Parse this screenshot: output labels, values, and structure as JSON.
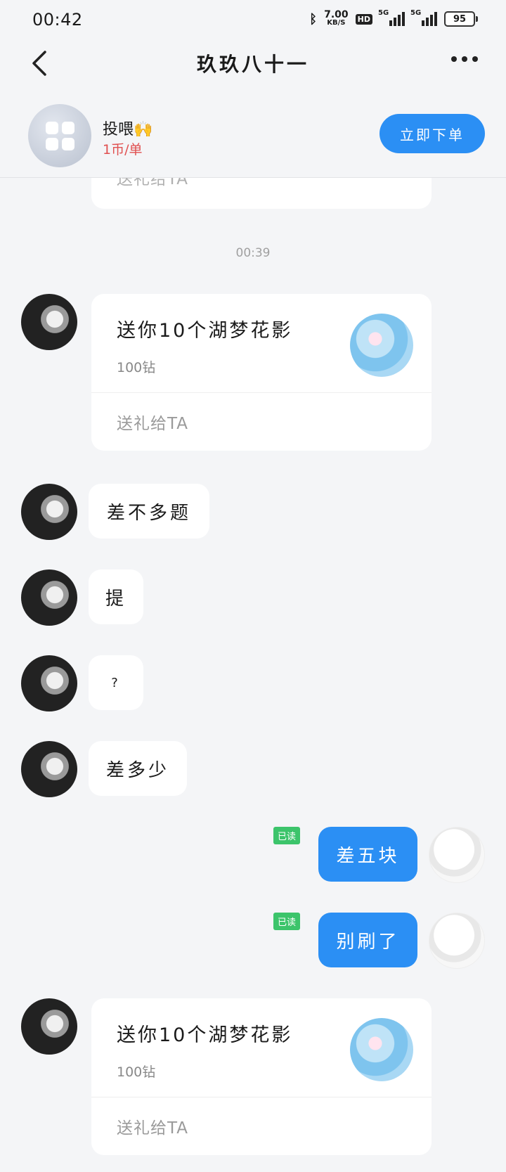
{
  "status_bar": {
    "time": "00:42",
    "network_speed_value": "7.00",
    "network_speed_unit": "KB/S",
    "hd_badge": "HD",
    "signal1": "5G",
    "signal2": "5G",
    "battery": "95"
  },
  "header": {
    "title": "玖玖八十一"
  },
  "service": {
    "name": "投喂🙌",
    "price": "1币/单",
    "order_button": "立即下单"
  },
  "chat": {
    "partial_card_label": "送礼给TA",
    "timestamp": "00:39",
    "gift1": {
      "title": "送你10个湖梦花影",
      "price": "100钻",
      "action": "送礼给TA"
    },
    "msg1": "差不多题",
    "msg2": "提",
    "msg3": "?",
    "msg4": "差多少",
    "out1": "差五块",
    "out1_status": "已读",
    "out2": "别刷了",
    "out2_status": "已读",
    "gift2": {
      "title": "送你10个湖梦花影",
      "price": "100钻",
      "action": "送礼给TA"
    }
  }
}
